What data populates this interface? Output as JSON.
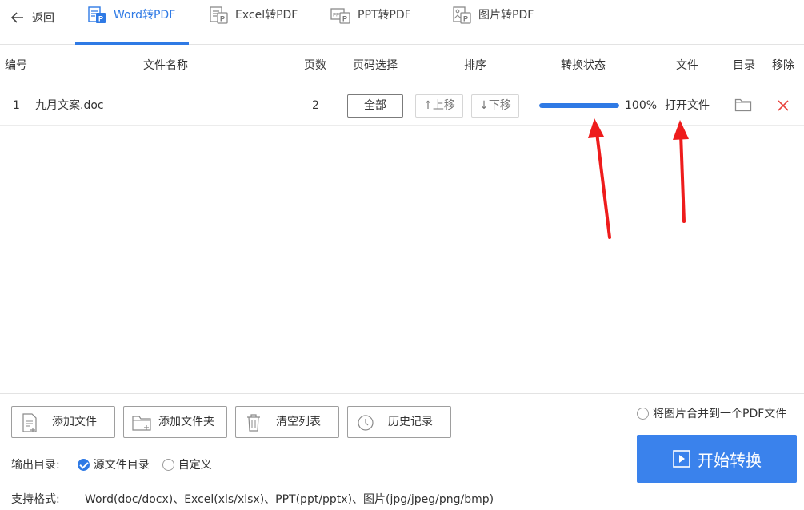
{
  "header": {
    "back_label": "返回",
    "tabs": [
      {
        "label": "Word转PDF",
        "active": true,
        "icon": "word-pdf-icon"
      },
      {
        "label": "Excel转PDF",
        "active": false,
        "icon": "excel-pdf-icon"
      },
      {
        "label": "PPT转PDF",
        "active": false,
        "icon": "ppt-pdf-icon"
      },
      {
        "label": "图片转PDF",
        "active": false,
        "icon": "image-pdf-icon"
      }
    ]
  },
  "table": {
    "columns": [
      "编号",
      "文件名称",
      "页数",
      "页码选择",
      "排序",
      "转换状态",
      "文件",
      "目录",
      "移除"
    ],
    "rows": [
      {
        "index": "1",
        "filename": "九月文案.doc",
        "pages": "2",
        "page_select": "全部",
        "move_up": "↑上移",
        "move_down": "↓下移",
        "progress": 100,
        "progress_text": "100%",
        "open_file": "打开文件"
      }
    ]
  },
  "actions": {
    "add_file": "添加文件",
    "add_folder": "添加文件夹",
    "clear_list": "清空列表",
    "history": "历史记录"
  },
  "merge_option": "将图片合并到一个PDF文件",
  "start_button": "开始转换",
  "output": {
    "label": "输出目录:",
    "options": [
      {
        "label": "源文件目录",
        "checked": true
      },
      {
        "label": "自定义",
        "checked": false
      }
    ]
  },
  "formats": {
    "label": "支持格式:",
    "text": "Word(doc/docx)、Excel(xls/xlsx)、PPT(ppt/pptx)、图片(jpg/jpeg/png/bmp)"
  },
  "colors": {
    "accent": "#2f7ae5",
    "start_button": "#3a82ec",
    "remove": "#e8403a",
    "annotation_arrow": "#ee1c1c"
  }
}
